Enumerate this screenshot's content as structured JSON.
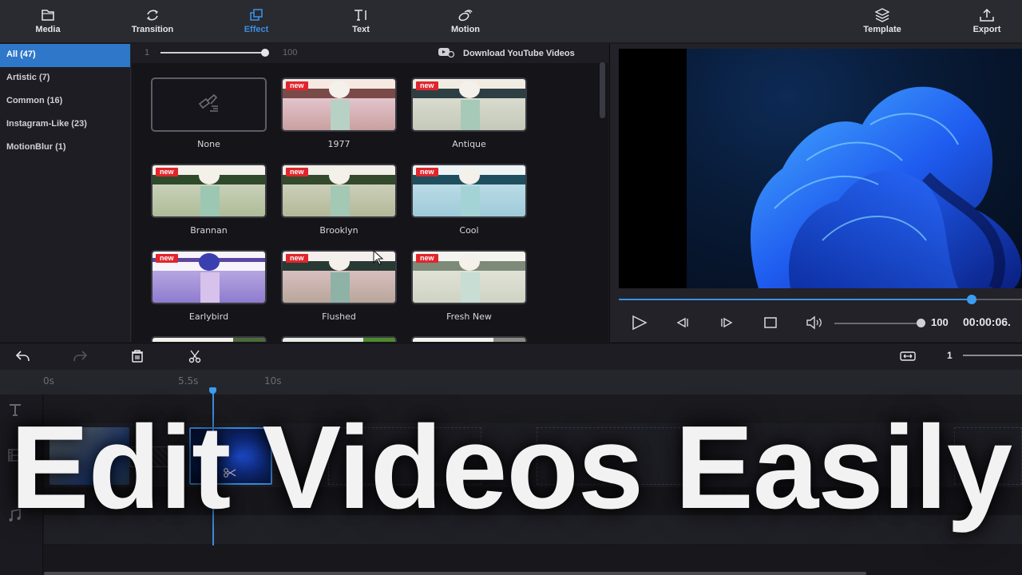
{
  "toolbar": {
    "items": [
      {
        "label": "Media",
        "icon": "folder-icon",
        "active": false
      },
      {
        "label": "Transition",
        "icon": "transition-icon",
        "active": false
      },
      {
        "label": "Effect",
        "icon": "effect-icon",
        "active": true
      },
      {
        "label": "Text",
        "icon": "text-icon",
        "active": false
      },
      {
        "label": "Motion",
        "icon": "motion-icon",
        "active": false
      }
    ],
    "right_items": [
      {
        "label": "Template",
        "icon": "layers-icon"
      },
      {
        "label": "Export",
        "icon": "export-icon"
      }
    ]
  },
  "categories": [
    {
      "label": "All  (47)",
      "active": true
    },
    {
      "label": "Artistic  (7)",
      "active": false
    },
    {
      "label": "Common  (16)",
      "active": false
    },
    {
      "label": "Instagram-Like  (23)",
      "active": false
    },
    {
      "label": "MotionBlur  (1)",
      "active": false
    }
  ],
  "effects_panel": {
    "size_slider": {
      "min": "1",
      "max": "100",
      "value_fraction": 1.0
    },
    "download_label": "Download YouTube Videos",
    "badge_label": "new",
    "effects": [
      {
        "label": "None",
        "is_new": false
      },
      {
        "label": "1977",
        "is_new": true
      },
      {
        "label": "Antique",
        "is_new": true
      },
      {
        "label": "Brannan",
        "is_new": true
      },
      {
        "label": "Brooklyn",
        "is_new": true
      },
      {
        "label": "Cool",
        "is_new": true
      },
      {
        "label": "Earlybird",
        "is_new": true
      },
      {
        "label": "Flushed",
        "is_new": true
      },
      {
        "label": "Fresh New",
        "is_new": true
      }
    ]
  },
  "player": {
    "progress_fraction": 0.875,
    "volume": "100",
    "volume_fraction": 1.0,
    "timecode": "00:00:06.",
    "accent_color": "#3b8fe0"
  },
  "timeline": {
    "zoom_value": "1",
    "ruler_labels": [
      "0s",
      "5.5s",
      "10s"
    ],
    "playhead_time": "6s"
  },
  "overlay": {
    "title": "Edit Videos Easily"
  }
}
